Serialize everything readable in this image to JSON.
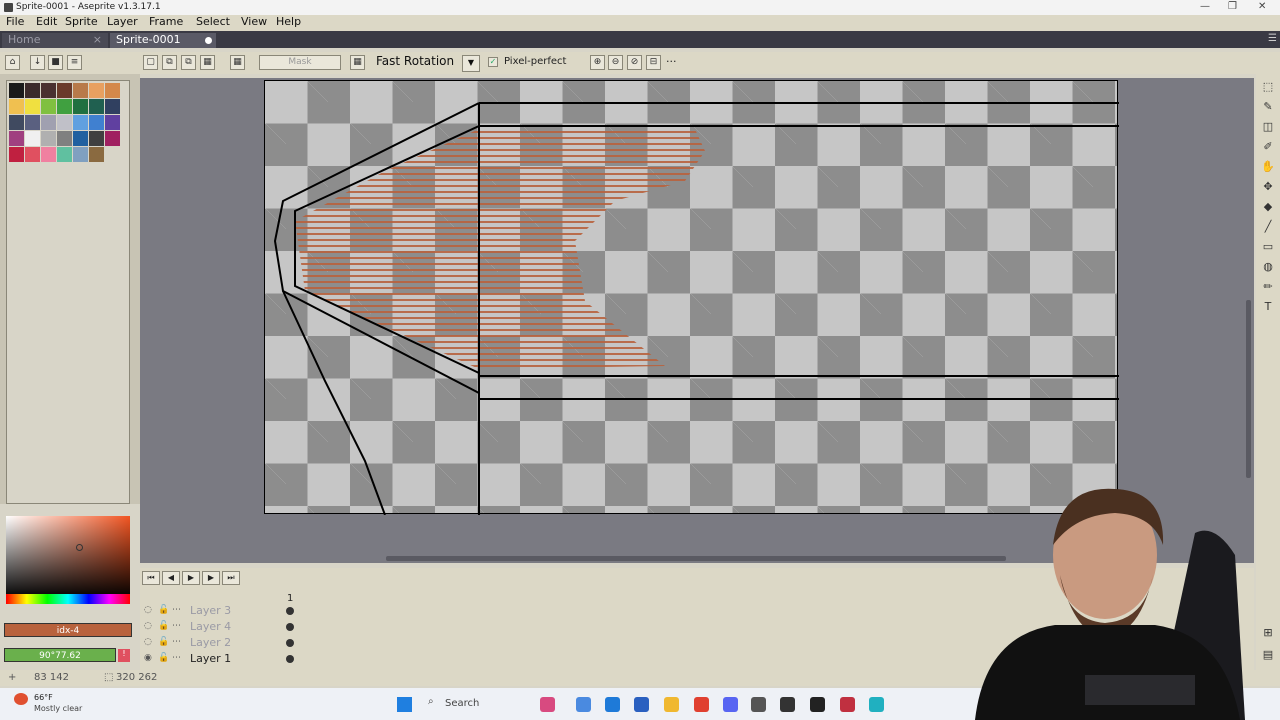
{
  "window": {
    "title": "Sprite-0001 - Aseprite v1.3.17.1",
    "min": "—",
    "max": "❐",
    "close": "✕"
  },
  "menu": [
    "File",
    "Edit",
    "Sprite",
    "Layer",
    "Frame",
    "Select",
    "View",
    "Help"
  ],
  "tabs": {
    "home": "Home",
    "close_home": "×",
    "sprite": "Sprite-0001"
  },
  "context": {
    "mask_label": "Mask",
    "rotation": "Fast Rotation",
    "pixel_perfect": "Pixel-perfect"
  },
  "palette_colors": [
    "#1a1a1a",
    "#3b2a2a",
    "#4a3030",
    "#6a3a2a",
    "#b87a4a",
    "#e8a060",
    "#d4884a",
    "#f0c050",
    "#f0e040",
    "#80c040",
    "#40a040",
    "#207040",
    "#206050",
    "#304060",
    "#404a60",
    "#5a6080",
    "#a0a0b0",
    "#c0c0c8",
    "#60a0e0",
    "#4080d0",
    "#6040a0",
    "#a04080",
    "#f0f0f0",
    "#b0b0b0",
    "#808080",
    "#2060a0",
    "#404040",
    "#a02060",
    "#c02040",
    "#e05060",
    "#f080a0",
    "#60c0a0",
    "#80a0c0",
    "#8a6a40"
  ],
  "colors": {
    "accent_fg": "#b8623d",
    "accent_bg": "#6ab04c",
    "fg_label": "idx-4",
    "bg_label": "90°77.62"
  },
  "timeline": {
    "frame_number": "1",
    "layers": [
      {
        "name": "Layer 3",
        "visible": false
      },
      {
        "name": "Layer 4",
        "visible": false
      },
      {
        "name": "Layer 2",
        "visible": false
      },
      {
        "name": "Layer 1",
        "visible": true
      }
    ]
  },
  "status": {
    "cursor": "83 142",
    "size": "320 262"
  },
  "taskbar": {
    "weather_temp": "66°F",
    "weather_desc": "Mostly clear",
    "search": "Search"
  }
}
